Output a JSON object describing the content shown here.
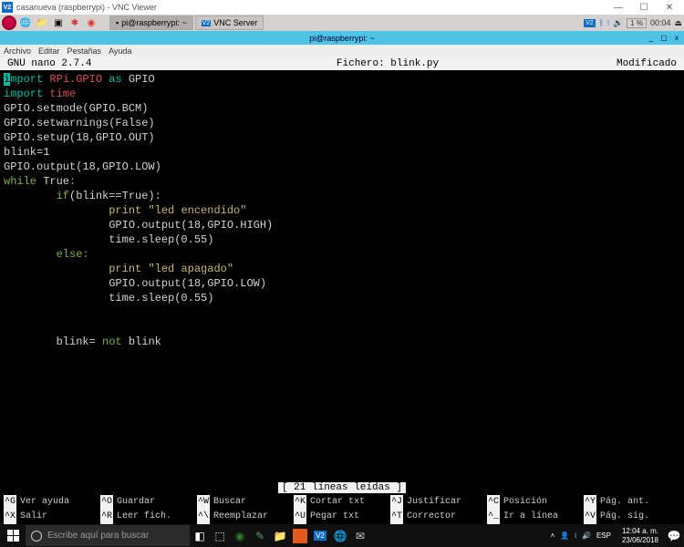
{
  "windows": {
    "vnc_title": "casanueva (raspberrypi) - VNC Viewer",
    "controls": {
      "min": "—",
      "max": "☐",
      "close": "✕"
    }
  },
  "lxpanel": {
    "task1": "pi@raspberrypi: ~",
    "task2": "VNC Server",
    "cpu": "1 %",
    "time": "00:04",
    "bt_icon": "*"
  },
  "term": {
    "title": "pi@raspberrypi: ~",
    "menu": {
      "archivo": "Archivo",
      "editar": "Editar",
      "pestanas": "Pestañas",
      "ayuda": "Ayuda"
    },
    "btns": {
      "min": "_",
      "max": "▢",
      "close": "x"
    }
  },
  "nano": {
    "version": "GNU nano 2.7.4",
    "file_label": "Fichero: blink.py",
    "modified": "Modificado",
    "status": "[ 21 líneas leídas ]",
    "code": {
      "l1a": "i",
      "l1b": "mport ",
      "l1c": "RPi.GPIO",
      "l1d": " as ",
      "l1e": "GPIO",
      "l2a": "import ",
      "l2b": "time",
      "l3": "GPIO.setmode(GPIO.BCM)",
      "l4": "GPIO.setwarnings(False)",
      "l5": "GPIO.setup(18,GPIO.OUT)",
      "l6": "blink=1",
      "l7": "GPIO.output(18,GPIO.LOW)",
      "l8a": "while ",
      "l8b": "True",
      "l9a": "        if",
      "l9b": "(blink==True):",
      "l10a": "                print ",
      "l10b": "\"led encendido\"",
      "l11": "                GPIO.output(18,GPIO.HIGH)",
      "l12": "                time.sleep(0.55)",
      "l13a": "        else",
      "l14a": "                print ",
      "l14b": "\"led apagado\"",
      "l15": "                GPIO.output(18,GPIO.LOW)",
      "l16": "                time.sleep(0.55)",
      "l18a": "        blink= ",
      "l18b": "not ",
      "l18c": "blink"
    },
    "shortcuts": {
      "g": {
        "k": "^G",
        "l": "Ver ayuda"
      },
      "x": {
        "k": "^X",
        "l": "Salir"
      },
      "o": {
        "k": "^O",
        "l": "Guardar"
      },
      "r": {
        "k": "^R",
        "l": "Leer fich."
      },
      "w": {
        "k": "^W",
        "l": "Buscar"
      },
      "bs": {
        "k": "^\\",
        "l": "Reemplazar"
      },
      "kk": {
        "k": "^K",
        "l": "Cortar txt"
      },
      "u": {
        "k": "^U",
        "l": "Pegar txt"
      },
      "j": {
        "k": "^J",
        "l": "Justificar"
      },
      "t": {
        "k": "^T",
        "l": "Corrector"
      },
      "c": {
        "k": "^C",
        "l": "Posición"
      },
      "sl": {
        "k": "^_",
        "l": "Ir a línea"
      },
      "y": {
        "k": "^Y",
        "l": "Pág. ant."
      },
      "v": {
        "k": "^V",
        "l": "Pág. sig."
      }
    }
  },
  "taskbar": {
    "search_placeholder": "Escribe aquí para buscar",
    "clock": {
      "time": "12:04 a. m.",
      "date": "23/06/2018"
    }
  }
}
